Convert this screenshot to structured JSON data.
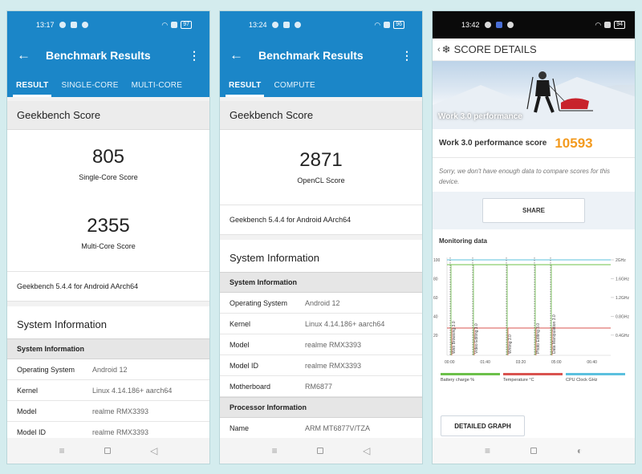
{
  "phone1": {
    "time": "13:17",
    "battery": "97",
    "title": "Benchmark Results",
    "tabs": [
      "RESULT",
      "SINGLE-CORE",
      "MULTI-CORE"
    ],
    "section_title": "Geekbench Score",
    "single_score": "805",
    "single_label": "Single-Core Score",
    "multi_score": "2355",
    "multi_label": "Multi-Core Score",
    "version": "Geekbench 5.4.4 for Android AArch64",
    "sys_title": "System Information",
    "sys_sub": "System Information",
    "rows": [
      {
        "k": "Operating System",
        "v": "Android 12"
      },
      {
        "k": "Kernel",
        "v": "Linux 4.14.186+ aarch64"
      },
      {
        "k": "Model",
        "v": "realme RMX3393"
      },
      {
        "k": "Model ID",
        "v": "realme RMX3393"
      }
    ]
  },
  "phone2": {
    "time": "13:24",
    "battery": "96",
    "title": "Benchmark Results",
    "tabs": [
      "RESULT",
      "COMPUTE"
    ],
    "section_title": "Geekbench Score",
    "score": "2871",
    "score_label": "OpenCL Score",
    "version": "Geekbench 5.4.4 for Android AArch64",
    "sys_title": "System Information",
    "sys_sub": "System Information",
    "rows": [
      {
        "k": "Operating System",
        "v": "Android 12"
      },
      {
        "k": "Kernel",
        "v": "Linux 4.14.186+ aarch64"
      },
      {
        "k": "Model",
        "v": "realme RMX3393"
      },
      {
        "k": "Model ID",
        "v": "realme RMX3393"
      },
      {
        "k": "Motherboard",
        "v": "RM6877"
      }
    ],
    "proc_sub": "Processor Information",
    "proc_rows": [
      {
        "k": "Name",
        "v": "ARM MT6877V/TZA"
      }
    ]
  },
  "phone3": {
    "time": "13:42",
    "battery": "94",
    "title": "SCORE DETAILS",
    "hero_label": "Work 3.0 performance",
    "perf_label": "Work 3.0 performance score",
    "perf_value": "10593",
    "note": "Sorry, we don't have enough data to compare scores for this device.",
    "share": "SHARE",
    "monitor": "Monitoring data",
    "detail": "DETAILED GRAPH",
    "chart_data": {
      "type": "line",
      "x_ticks": [
        "00:00",
        "01:40",
        "03:20",
        "05:00",
        "06:40"
      ],
      "y_ticks_left": [
        "100",
        "80",
        "60",
        "40",
        "20"
      ],
      "y_ticks_right": [
        "2GHz",
        "1.6GHz",
        "1.2GHz",
        "0.8GHz",
        "0.4GHz"
      ],
      "annotations": [
        "Web Browsing 3.0",
        "Video Editing 3.0",
        "Writing 3.0",
        "Photo Editing 3.0",
        "Data Manipulation 3.0"
      ],
      "legend": [
        "Battery charge %",
        "Temperature °C",
        "CPU Clock GHz"
      ],
      "colors": {
        "battery": "#6cc04a",
        "temperature": "#d9534f",
        "cpu": "#5bc0de"
      }
    }
  }
}
